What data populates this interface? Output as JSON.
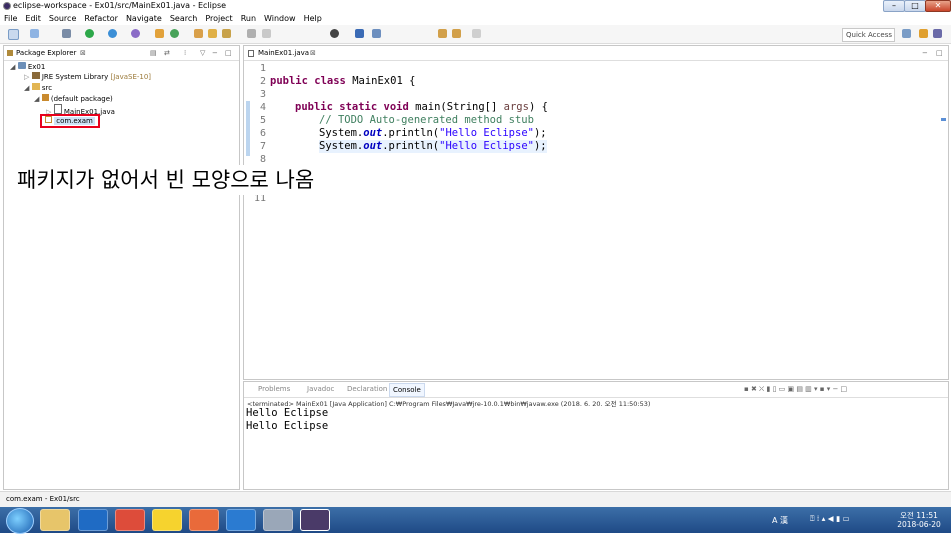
{
  "window": {
    "title": "eclipse-workspace - Ex01/src/MainEx01.java - Eclipse"
  },
  "menu": [
    "File",
    "Edit",
    "Source",
    "Refactor",
    "Navigate",
    "Search",
    "Project",
    "Run",
    "Window",
    "Help"
  ],
  "toolbar": {
    "quick_access": "Quick Access"
  },
  "package_explorer": {
    "tab": "Package Explorer",
    "tree": [
      {
        "label": "Ex01",
        "icon": "project-icon"
      },
      {
        "label": "JRE System Library",
        "extra": "[JavaSE-10]",
        "icon": "library-icon"
      },
      {
        "label": "src",
        "icon": "folder-icon"
      },
      {
        "label": "(default package)",
        "icon": "package-icon"
      },
      {
        "label": "MainEx01.java",
        "icon": "java-file-icon"
      },
      {
        "label": "com.exam",
        "icon": "empty-package-icon"
      }
    ]
  },
  "editor": {
    "tab": "MainEx01.java",
    "line_numbers": [
      "1",
      "2",
      "3",
      "4",
      "5",
      "6",
      "7",
      "8",
      "9",
      "10",
      "11"
    ],
    "code": {
      "l2_kw1": "public",
      "l2_kw2": "class",
      "l2_rest": " MainEx01 {",
      "l4_kw1": "public",
      "l4_kw2": "static",
      "l4_kw3": "void",
      "l4_rest1": " main(String[] ",
      "l4_args": "args",
      "l4_rest2": ") {",
      "l5": "// TODO Auto-generated method stub",
      "l6_a": "System.",
      "l6_out": "out",
      "l6_b": ".println(",
      "l6_str": "\"Hello Eclipse\"",
      "l6_c": ");",
      "l7_a": "System.",
      "l7_out": "out",
      "l7_b": ".println(",
      "l7_str": "\"Hello Eclipse\"",
      "l7_c": ");"
    }
  },
  "overlay_note": "패키지가 없어서 빈 모양으로 나옴",
  "console": {
    "tabs": [
      "Problems",
      "Javadoc",
      "Declaration",
      "Console"
    ],
    "terminated": "<terminated> MainEx01 [Java Application] C:₩Program Files₩Java₩jre-10.0.1₩bin₩javaw.exe (2018. 6. 20. 오전 11:50:53)",
    "output": [
      "Hello Eclipse",
      "Hello Eclipse"
    ]
  },
  "status": {
    "text": "com.exam - Ex01/src"
  },
  "taskbar": {
    "time": "오전 11:51",
    "date": "2018-06-20",
    "ime": "A 漢"
  },
  "colors": {
    "highlight_box": "#e8001c",
    "taskbar": "#2b5c96",
    "keyword": "#7f0055",
    "comment": "#3f7f5f",
    "string": "#2a00ff"
  }
}
